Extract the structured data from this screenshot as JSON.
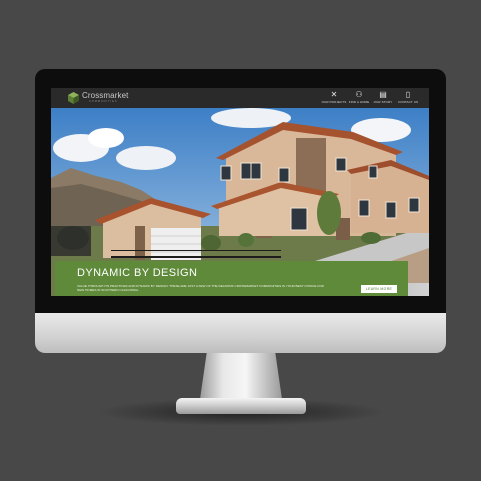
{
  "brand": {
    "name": "Crossmarket",
    "tagline": "COMMUNITIES"
  },
  "nav": [
    {
      "label": "OUR PROJECTS",
      "icon": "tools-icon"
    },
    {
      "label": "FIND A HOME",
      "icon": "people-icon"
    },
    {
      "label": "OUR STORY",
      "icon": "book-icon"
    },
    {
      "label": "CONTACT US",
      "icon": "phone-icon"
    }
  ],
  "hero": {
    "title": "DYNAMIC BY DESIGN",
    "text": "VALUE THROUGH ITS PRACTICES AND DYNAMIC BY DESIGN: THESE ARE JUST A FEW OF THE REASONS CROSSMARKET COMMUNITIES IS YOUR BEST CHOICE FOR NEW HOMES IN SOUTHERN CALIFORNIA.",
    "button": "LEARN MORE"
  },
  "colors": {
    "background": "#484848",
    "banner_green": "#5e8a3a",
    "navbar": "#2a2a2a"
  }
}
